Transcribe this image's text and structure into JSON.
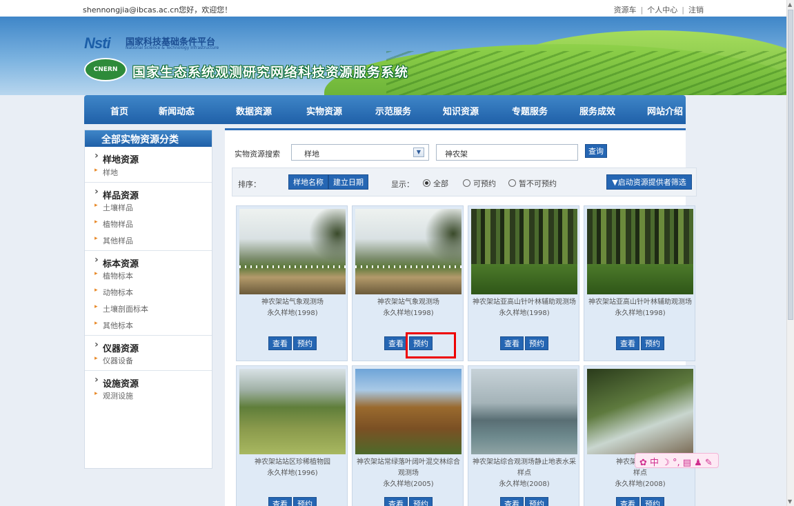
{
  "topbar": {
    "welcome": "shennongjia@ibcas.ac.cn您好，欢迎您！",
    "links": [
      "资源车",
      "个人中心",
      "注销"
    ],
    "sep": "|"
  },
  "banner": {
    "brand_logo": "Nsti",
    "platform_cn": "国家科技基础条件平台",
    "platform_en": "National Science & Technology Infrastructure",
    "emblem": "CNERN",
    "system_title": "国家生态系统观测研究网络科技资源服务系统"
  },
  "nav": [
    "首页",
    "新闻动态",
    "数据资源",
    "实物资源",
    "示范服务",
    "知识资源",
    "专题服务",
    "服务成效",
    "网站介绍"
  ],
  "sidebar": {
    "title": "全部实物资源分类",
    "categories": [
      {
        "label": "样地资源",
        "items": [
          "样地"
        ]
      },
      {
        "label": "样品资源",
        "items": [
          "土壤样品",
          "植物样品",
          "其他样品"
        ]
      },
      {
        "label": "标本资源",
        "items": [
          "植物标本",
          "动物标本",
          "土壤剖面标本",
          "其他标本"
        ]
      },
      {
        "label": "仪器资源",
        "items": [
          "仪器设备"
        ]
      },
      {
        "label": "设施资源",
        "items": [
          "观测设施"
        ]
      }
    ]
  },
  "search": {
    "label": "实物资源搜索",
    "select_value": "样地",
    "input_value": "神农架",
    "button": "查询"
  },
  "sortbar": {
    "sort_label": "排序：",
    "sort_buttons": [
      "样地名称",
      "建立日期"
    ],
    "show_label": "显示：",
    "radios": [
      "全部",
      "可预约",
      "暂不可预约"
    ],
    "selected_radio": "全部",
    "filter_button": "▼启动资源提供者筛选"
  },
  "cards": [
    {
      "title": "神农架站气象观测场",
      "sub": "永久样地(1998)",
      "image": "mountain-autumn-field"
    },
    {
      "title": "神农架站气象观测场",
      "sub": "永久样地(1998)",
      "image": "mountain-autumn-field"
    },
    {
      "title": "神农架站亚高山针叶林辅助观测场",
      "sub": "永久样地(1998)",
      "image": "conifer-forest"
    },
    {
      "title": "神农架站亚高山针叶林辅助观测场",
      "sub": "永久样地(1998)",
      "image": "conifer-forest"
    },
    {
      "title": "神农架站站区珍稀植物园",
      "sub": "永久样地(1996)",
      "image": "valley-garden"
    },
    {
      "title": "神农架站常绿落叶阔叶混交林综合",
      "title2": "观测场",
      "sub": "永久样地(2005)",
      "image": "autumn-hills"
    },
    {
      "title": "神农架站综合观测场静止地表水采",
      "title2": "样点",
      "sub": "永久样地(2008)",
      "image": "reservoir-dam"
    },
    {
      "title": "神农架站综合观",
      "title2": "样点",
      "sub": "永久样地(2008)",
      "image": "stream-sampling"
    }
  ],
  "card_buttons": {
    "view": "查看",
    "reserve": "预约"
  },
  "ime_toolbar": "中 ☽ °, ▤ ♟ ✎",
  "colors": {
    "accent": "#2566b3",
    "highlight": "#e00000",
    "nav": "#1f60a8"
  }
}
